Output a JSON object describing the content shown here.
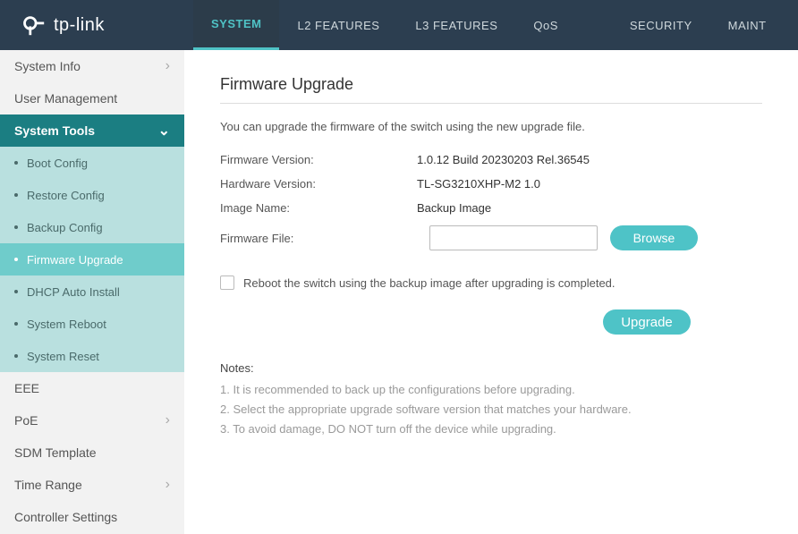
{
  "header": {
    "brand": "tp-link",
    "tabs": [
      {
        "label": "SYSTEM",
        "active": true
      },
      {
        "label": "L2 FEATURES",
        "active": false
      },
      {
        "label": "L3 FEATURES",
        "active": false
      },
      {
        "label": "QoS",
        "active": false
      },
      {
        "label": "SECURITY",
        "active": false
      },
      {
        "label": "MAINT",
        "active": false
      }
    ]
  },
  "sidebar": {
    "items": [
      {
        "label": "System Info",
        "chevron": "right"
      },
      {
        "label": "User Management"
      },
      {
        "label": "System Tools",
        "open": true,
        "chevron": "down"
      },
      {
        "label": "EEE"
      },
      {
        "label": "PoE",
        "chevron": "right"
      },
      {
        "label": "SDM Template"
      },
      {
        "label": "Time Range",
        "chevron": "right"
      },
      {
        "label": "Controller Settings"
      }
    ],
    "system_tools_sub": [
      {
        "label": "Boot Config"
      },
      {
        "label": "Restore Config"
      },
      {
        "label": "Backup Config"
      },
      {
        "label": "Firmware Upgrade",
        "active": true
      },
      {
        "label": "DHCP Auto Install"
      },
      {
        "label": "System Reboot"
      },
      {
        "label": "System Reset"
      }
    ]
  },
  "main": {
    "title": "Firmware Upgrade",
    "intro": "You can upgrade the firmware of the switch using the new upgrade file.",
    "rows": {
      "fw_version_label": "Firmware Version:",
      "fw_version_value": "1.0.12 Build 20230203 Rel.36545",
      "hw_version_label": "Hardware Version:",
      "hw_version_value": "TL-SG3210XHP-M2 1.0",
      "image_name_label": "Image Name:",
      "image_name_value": "Backup Image",
      "firmware_file_label": "Firmware File:",
      "firmware_file_value": ""
    },
    "browse_btn": "Browse",
    "checkbox_label": "Reboot the switch using the backup image after upgrading is completed.",
    "upgrade_btn": "Upgrade",
    "notes_title": "Notes:",
    "notes": [
      "1. It is recommended to back up the configurations before upgrading.",
      "2. Select the appropriate upgrade software version that matches your hardware.",
      "3. To avoid damage, DO NOT turn off the device while upgrading."
    ]
  }
}
